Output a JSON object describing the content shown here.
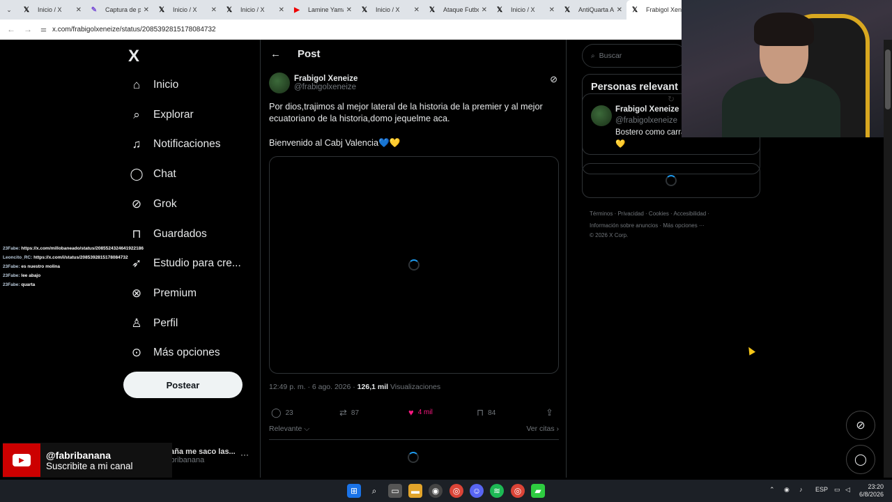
{
  "browser": {
    "tabs": [
      {
        "label": "Inicio / X",
        "icon": "x-icon"
      },
      {
        "label": "Captura de pa",
        "icon": "pen-icon"
      },
      {
        "label": "Inicio / X",
        "icon": "x-icon"
      },
      {
        "label": "Inicio / X",
        "icon": "x-icon"
      },
      {
        "label": "Lamine Yamal",
        "icon": "youtube-icon"
      },
      {
        "label": "Inicio / X",
        "icon": "x-icon"
      },
      {
        "label": "Ataque Futbo",
        "icon": "x-icon"
      },
      {
        "label": "Inicio / X",
        "icon": "x-icon"
      },
      {
        "label": "AntiQuarta A",
        "icon": "x-icon"
      },
      {
        "label": "Frabigol Xene",
        "icon": "x-icon",
        "active": true
      }
    ],
    "url": "x.com/frabigolxeneize/status/2085392815178084732"
  },
  "sidebar": {
    "logo": "X",
    "items": [
      {
        "label": "Inicio",
        "icon": "home-icon"
      },
      {
        "label": "Explorar",
        "icon": "search-icon"
      },
      {
        "label": "Notificaciones",
        "icon": "bell-icon"
      },
      {
        "label": "Chat",
        "icon": "chat-icon"
      },
      {
        "label": "Grok",
        "icon": "grok-icon"
      },
      {
        "label": "Guardados",
        "icon": "bookmark-icon"
      },
      {
        "label": "Estudio para cre...",
        "icon": "rocket-icon"
      },
      {
        "label": "Premium",
        "icon": "premium-icon"
      },
      {
        "label": "Perfil",
        "icon": "person-icon"
      },
      {
        "label": "Más opciones",
        "icon": "more-icon"
      }
    ],
    "post_button": "Postear",
    "user": {
      "name": "España me saco las...",
      "handle": "@fabribanana"
    }
  },
  "overlay": {
    "chat_lines": [
      {
        "user": "23Fabe:",
        "text": "https://x.com/millobaneado/status/2085524324641922186"
      },
      {
        "user": "Leoncito_RC:",
        "text": "https://x.com/i/status/2085392815178084732"
      },
      {
        "user": "23Fabe:",
        "text": "es nuestro molina"
      },
      {
        "user": "23Fabe:",
        "text": "lee abajo"
      },
      {
        "user": "23Fabe:",
        "text": "quarta"
      }
    ],
    "yt_handle": "@fabribanana",
    "yt_sub": "Suscribite a mi canal"
  },
  "post": {
    "header_title": "Post",
    "author_name": "Frabigol Xeneize",
    "author_handle": "@frabigolxeneize",
    "text_line1": "Por dios,trajimos al mejor lateral de la historia de la premier y al mejor",
    "text_line2": "ecuatoriano de la historia,domo jequelme aca.",
    "text_line3": "Bienvenido al Cabj Valencia💙💛",
    "time": "12:49 p. m. · 6 ago. 2026 · ",
    "views_count": "126,1 mil",
    "views_label": " Visualizaciones",
    "replies": "23",
    "reposts": "87",
    "likes": "4 mil",
    "bookmarks": "84",
    "sort_label": "Relevante ⌵",
    "quotes_label": "Ver citas ›"
  },
  "right": {
    "search_placeholder": "Buscar",
    "relevant_title": "Personas relevant",
    "rel_name": "Frabigol Xeneize",
    "rel_handle": "@frabigolxeneize",
    "rel_bio": "Bostero como carras",
    "rel_bio2": "💛",
    "footer_line1": "Términos  ·  Privacidad  ·  Cookies  ·  Accesibilidad  ·",
    "footer_line2": "Información sobre anuncios  ·  Más opciones ···",
    "footer_line3": "© 2026 X Corp."
  },
  "taskbar": {
    "lang": "ESP",
    "time": "23:20",
    "date": "6/8/2026"
  },
  "colors": {
    "accent": "#1d9bf0",
    "like": "#f91880",
    "bg": "#000000"
  }
}
